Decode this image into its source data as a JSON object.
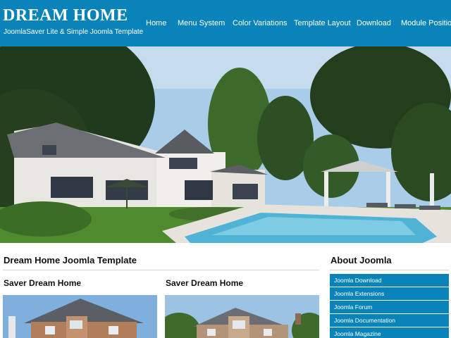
{
  "header": {
    "logo": "DREAM HOME",
    "tagline": "JoomlaSaver Lite & Simple Joomla Template"
  },
  "nav": {
    "items": [
      {
        "label": "Home"
      },
      {
        "label": "Menu System"
      },
      {
        "label": "Color Variations"
      },
      {
        "label": "Template Layout"
      },
      {
        "label": "Download"
      },
      {
        "label": "Module Position"
      }
    ]
  },
  "main": {
    "title": "Dream Home Joomla Template",
    "cards": [
      {
        "title": "Saver Dream Home"
      },
      {
        "title": "Saver Dream Home"
      }
    ]
  },
  "sidebar": {
    "title": "About Joomla",
    "items": [
      {
        "label": "Joomla Download"
      },
      {
        "label": "Joomla Extensions"
      },
      {
        "label": "Joomla Forum"
      },
      {
        "label": "Joomla Documentation"
      },
      {
        "label": "Joomla Magazine"
      }
    ]
  },
  "colors": {
    "brand": "#0a84b8",
    "text": "#111111",
    "background": "#ffffff"
  }
}
